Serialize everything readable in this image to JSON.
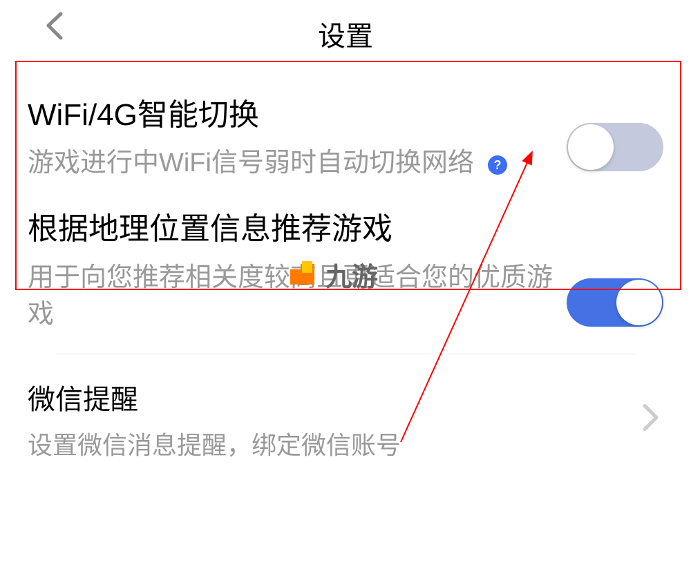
{
  "header": {
    "title": "设置"
  },
  "settings": {
    "wifi": {
      "title": "WiFi/4G智能切换",
      "description": "游戏进行中WiFi信号弱时自动切换网络",
      "enabled": false
    },
    "location": {
      "title": "根据地理位置信息推荐游戏",
      "description": "用于向您推荐相关度较高且更适合您的优质游戏",
      "enabled": true
    },
    "wechat": {
      "title": "微信提醒",
      "description": "设置微信消息提醒，绑定微信账号"
    }
  },
  "watermark": {
    "text": "九游"
  }
}
